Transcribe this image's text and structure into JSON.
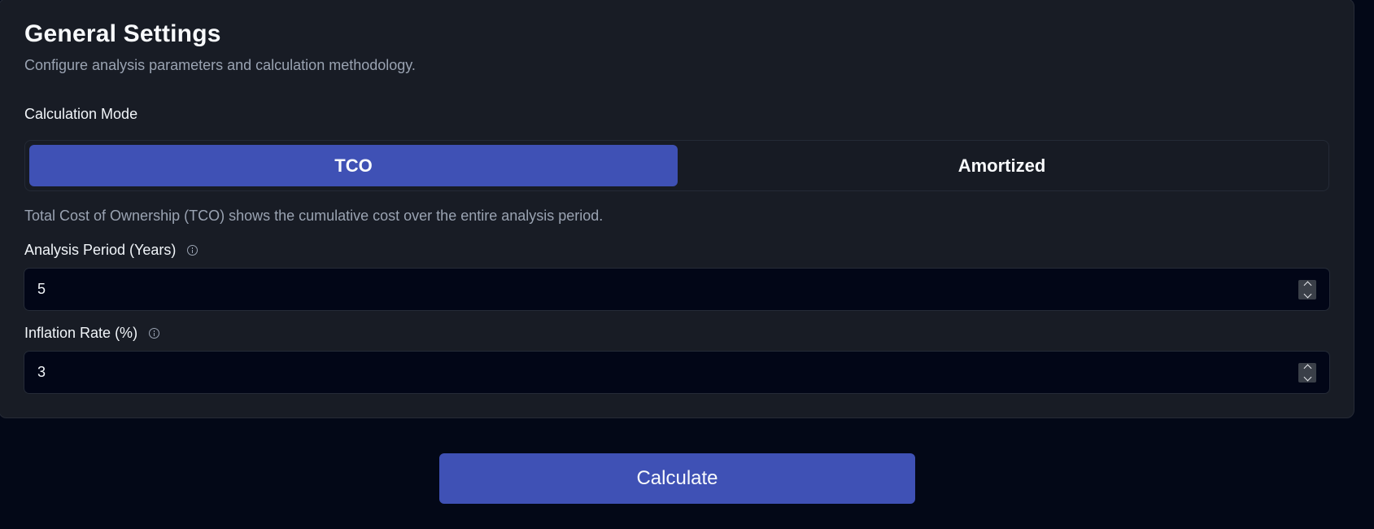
{
  "settings": {
    "title": "General Settings",
    "subtitle": "Configure analysis parameters and calculation methodology.",
    "calculation_mode": {
      "label": "Calculation Mode",
      "options": [
        {
          "label": "TCO",
          "selected": true
        },
        {
          "label": "Amortized",
          "selected": false
        }
      ],
      "description": "Total Cost of Ownership (TCO) shows the cumulative cost over the entire analysis period."
    },
    "analysis_period": {
      "label": "Analysis Period (Years)",
      "value": "5"
    },
    "inflation_rate": {
      "label": "Inflation Rate (%)",
      "value": "3"
    }
  },
  "actions": {
    "calculate_label": "Calculate"
  },
  "colors": {
    "accent": "#3f51b5",
    "card_bg": "#181c25",
    "page_bg": "#030817",
    "input_bg": "#020617"
  },
  "icons": {
    "info": "info-circle-icon",
    "spinner_up": "chevron-up-icon",
    "spinner_down": "chevron-down-icon"
  }
}
